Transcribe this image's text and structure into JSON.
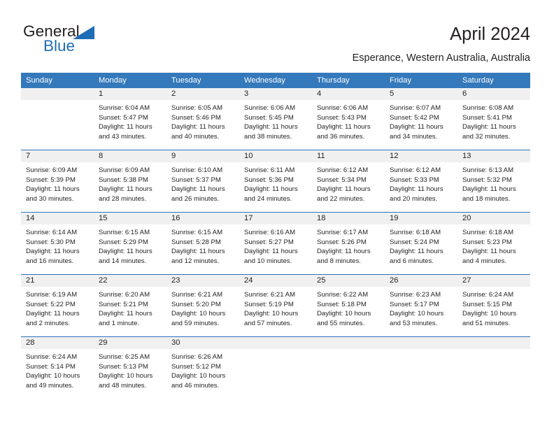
{
  "brand": {
    "name_part1": "General",
    "name_part2": "Blue",
    "logo_icon": "triangle-flag-icon",
    "accent_color": "#1f6db5"
  },
  "header": {
    "title": "April 2024",
    "subtitle": "Esperance, Western Australia, Australia"
  },
  "calendar": {
    "header_bg": "#3479bb",
    "daynum_bg": "#f0f0f0",
    "row_divider_color": "#2f72b4",
    "weekday_headers": [
      "Sunday",
      "Monday",
      "Tuesday",
      "Wednesday",
      "Thursday",
      "Friday",
      "Saturday"
    ],
    "weeks": [
      [
        {
          "day": "",
          "sunrise": "",
          "sunset": "",
          "daylight_line1": "",
          "daylight_line2": ""
        },
        {
          "day": "1",
          "sunrise": "Sunrise: 6:04 AM",
          "sunset": "Sunset: 5:47 PM",
          "daylight_line1": "Daylight: 11 hours",
          "daylight_line2": "and 43 minutes."
        },
        {
          "day": "2",
          "sunrise": "Sunrise: 6:05 AM",
          "sunset": "Sunset: 5:46 PM",
          "daylight_line1": "Daylight: 11 hours",
          "daylight_line2": "and 40 minutes."
        },
        {
          "day": "3",
          "sunrise": "Sunrise: 6:06 AM",
          "sunset": "Sunset: 5:45 PM",
          "daylight_line1": "Daylight: 11 hours",
          "daylight_line2": "and 38 minutes."
        },
        {
          "day": "4",
          "sunrise": "Sunrise: 6:06 AM",
          "sunset": "Sunset: 5:43 PM",
          "daylight_line1": "Daylight: 11 hours",
          "daylight_line2": "and 36 minutes."
        },
        {
          "day": "5",
          "sunrise": "Sunrise: 6:07 AM",
          "sunset": "Sunset: 5:42 PM",
          "daylight_line1": "Daylight: 11 hours",
          "daylight_line2": "and 34 minutes."
        },
        {
          "day": "6",
          "sunrise": "Sunrise: 6:08 AM",
          "sunset": "Sunset: 5:41 PM",
          "daylight_line1": "Daylight: 11 hours",
          "daylight_line2": "and 32 minutes."
        }
      ],
      [
        {
          "day": "7",
          "sunrise": "Sunrise: 6:09 AM",
          "sunset": "Sunset: 5:39 PM",
          "daylight_line1": "Daylight: 11 hours",
          "daylight_line2": "and 30 minutes."
        },
        {
          "day": "8",
          "sunrise": "Sunrise: 6:09 AM",
          "sunset": "Sunset: 5:38 PM",
          "daylight_line1": "Daylight: 11 hours",
          "daylight_line2": "and 28 minutes."
        },
        {
          "day": "9",
          "sunrise": "Sunrise: 6:10 AM",
          "sunset": "Sunset: 5:37 PM",
          "daylight_line1": "Daylight: 11 hours",
          "daylight_line2": "and 26 minutes."
        },
        {
          "day": "10",
          "sunrise": "Sunrise: 6:11 AM",
          "sunset": "Sunset: 5:36 PM",
          "daylight_line1": "Daylight: 11 hours",
          "daylight_line2": "and 24 minutes."
        },
        {
          "day": "11",
          "sunrise": "Sunrise: 6:12 AM",
          "sunset": "Sunset: 5:34 PM",
          "daylight_line1": "Daylight: 11 hours",
          "daylight_line2": "and 22 minutes."
        },
        {
          "day": "12",
          "sunrise": "Sunrise: 6:12 AM",
          "sunset": "Sunset: 5:33 PM",
          "daylight_line1": "Daylight: 11 hours",
          "daylight_line2": "and 20 minutes."
        },
        {
          "day": "13",
          "sunrise": "Sunrise: 6:13 AM",
          "sunset": "Sunset: 5:32 PM",
          "daylight_line1": "Daylight: 11 hours",
          "daylight_line2": "and 18 minutes."
        }
      ],
      [
        {
          "day": "14",
          "sunrise": "Sunrise: 6:14 AM",
          "sunset": "Sunset: 5:30 PM",
          "daylight_line1": "Daylight: 11 hours",
          "daylight_line2": "and 16 minutes."
        },
        {
          "day": "15",
          "sunrise": "Sunrise: 6:15 AM",
          "sunset": "Sunset: 5:29 PM",
          "daylight_line1": "Daylight: 11 hours",
          "daylight_line2": "and 14 minutes."
        },
        {
          "day": "16",
          "sunrise": "Sunrise: 6:15 AM",
          "sunset": "Sunset: 5:28 PM",
          "daylight_line1": "Daylight: 11 hours",
          "daylight_line2": "and 12 minutes."
        },
        {
          "day": "17",
          "sunrise": "Sunrise: 6:16 AM",
          "sunset": "Sunset: 5:27 PM",
          "daylight_line1": "Daylight: 11 hours",
          "daylight_line2": "and 10 minutes."
        },
        {
          "day": "18",
          "sunrise": "Sunrise: 6:17 AM",
          "sunset": "Sunset: 5:26 PM",
          "daylight_line1": "Daylight: 11 hours",
          "daylight_line2": "and 8 minutes."
        },
        {
          "day": "19",
          "sunrise": "Sunrise: 6:18 AM",
          "sunset": "Sunset: 5:24 PM",
          "daylight_line1": "Daylight: 11 hours",
          "daylight_line2": "and 6 minutes."
        },
        {
          "day": "20",
          "sunrise": "Sunrise: 6:18 AM",
          "sunset": "Sunset: 5:23 PM",
          "daylight_line1": "Daylight: 11 hours",
          "daylight_line2": "and 4 minutes."
        }
      ],
      [
        {
          "day": "21",
          "sunrise": "Sunrise: 6:19 AM",
          "sunset": "Sunset: 5:22 PM",
          "daylight_line1": "Daylight: 11 hours",
          "daylight_line2": "and 2 minutes."
        },
        {
          "day": "22",
          "sunrise": "Sunrise: 6:20 AM",
          "sunset": "Sunset: 5:21 PM",
          "daylight_line1": "Daylight: 11 hours",
          "daylight_line2": "and 1 minute."
        },
        {
          "day": "23",
          "sunrise": "Sunrise: 6:21 AM",
          "sunset": "Sunset: 5:20 PM",
          "daylight_line1": "Daylight: 10 hours",
          "daylight_line2": "and 59 minutes."
        },
        {
          "day": "24",
          "sunrise": "Sunrise: 6:21 AM",
          "sunset": "Sunset: 5:19 PM",
          "daylight_line1": "Daylight: 10 hours",
          "daylight_line2": "and 57 minutes."
        },
        {
          "day": "25",
          "sunrise": "Sunrise: 6:22 AM",
          "sunset": "Sunset: 5:18 PM",
          "daylight_line1": "Daylight: 10 hours",
          "daylight_line2": "and 55 minutes."
        },
        {
          "day": "26",
          "sunrise": "Sunrise: 6:23 AM",
          "sunset": "Sunset: 5:17 PM",
          "daylight_line1": "Daylight: 10 hours",
          "daylight_line2": "and 53 minutes."
        },
        {
          "day": "27",
          "sunrise": "Sunrise: 6:24 AM",
          "sunset": "Sunset: 5:15 PM",
          "daylight_line1": "Daylight: 10 hours",
          "daylight_line2": "and 51 minutes."
        }
      ],
      [
        {
          "day": "28",
          "sunrise": "Sunrise: 6:24 AM",
          "sunset": "Sunset: 5:14 PM",
          "daylight_line1": "Daylight: 10 hours",
          "daylight_line2": "and 49 minutes."
        },
        {
          "day": "29",
          "sunrise": "Sunrise: 6:25 AM",
          "sunset": "Sunset: 5:13 PM",
          "daylight_line1": "Daylight: 10 hours",
          "daylight_line2": "and 48 minutes."
        },
        {
          "day": "30",
          "sunrise": "Sunrise: 6:26 AM",
          "sunset": "Sunset: 5:12 PM",
          "daylight_line1": "Daylight: 10 hours",
          "daylight_line2": "and 46 minutes."
        },
        {
          "day": "",
          "sunrise": "",
          "sunset": "",
          "daylight_line1": "",
          "daylight_line2": ""
        },
        {
          "day": "",
          "sunrise": "",
          "sunset": "",
          "daylight_line1": "",
          "daylight_line2": ""
        },
        {
          "day": "",
          "sunrise": "",
          "sunset": "",
          "daylight_line1": "",
          "daylight_line2": ""
        },
        {
          "day": "",
          "sunrise": "",
          "sunset": "",
          "daylight_line1": "",
          "daylight_line2": ""
        }
      ]
    ]
  }
}
